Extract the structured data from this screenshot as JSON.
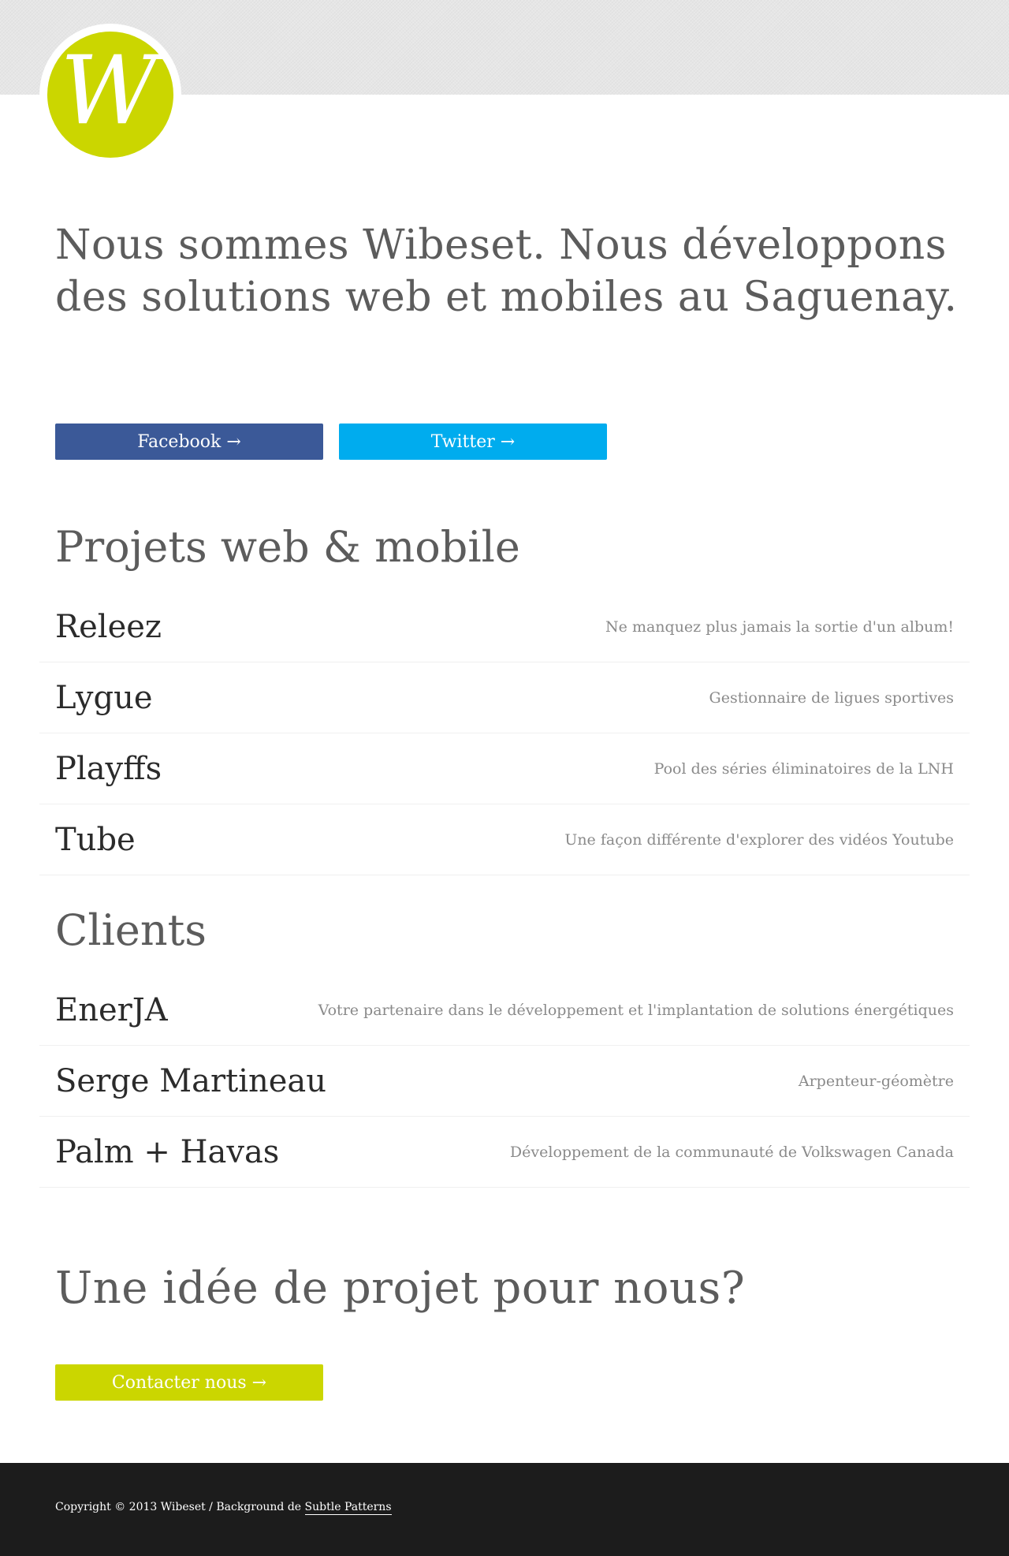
{
  "logo": {
    "letter": "W"
  },
  "hero": {
    "text": "Nous sommes Wibeset. Nous développons des solutions web et mobiles au Saguenay."
  },
  "social": {
    "facebook_label": "Facebook →",
    "twitter_label": "Twitter →"
  },
  "projects": {
    "title": "Projets web & mobile",
    "items": [
      {
        "name": "Releez",
        "desc": "Ne manquez plus jamais la sortie d'un album!"
      },
      {
        "name": "Lygue",
        "desc": "Gestionnaire de ligues sportives"
      },
      {
        "name": "Playffs",
        "desc": "Pool des séries éliminatoires de la LNH"
      },
      {
        "name": "Tube",
        "desc": "Une façon différente d'explorer des vidéos Youtube"
      }
    ]
  },
  "clients": {
    "title": "Clients",
    "items": [
      {
        "name": "EnerJA",
        "desc": "Votre partenaire dans le développement et l'implantation de solutions énergétiques"
      },
      {
        "name": "Serge Martineau",
        "desc": "Arpenteur-géomètre"
      },
      {
        "name": "Palm + Havas",
        "desc": "Développement de la communauté de Volkswagen Canada"
      }
    ]
  },
  "cta": {
    "title": "Une idée de projet pour nous?",
    "contact_label": "Contacter nous →"
  },
  "footer": {
    "copyright": "Copyright © 2013 Wibeset / Background de ",
    "link_label": "Subtle Patterns"
  },
  "colors": {
    "brand": "#cbd600",
    "facebook": "#3b5998",
    "twitter": "#00acee",
    "footer_bg": "#1c1c1c"
  }
}
